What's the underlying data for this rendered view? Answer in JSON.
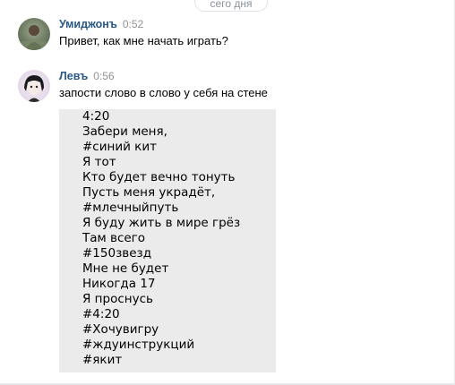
{
  "date_label": "сего дня",
  "messages": [
    {
      "author": "Умиджонъ",
      "time": "0:52",
      "text": "Привет, как мне начать играть?"
    },
    {
      "author": "Левъ",
      "time": "0:56",
      "text": "запости слово в слово у себя на стене"
    }
  ],
  "pasted_lines": [
    "4:20",
    "Забери меня,",
    "#синий кит",
    "Я тот",
    "Кто будет вечно тонуть",
    "Пусть меня украдёт,",
    "#млечныйпуть",
    "Я буду жить в мире грёз",
    "Там всего",
    "#150звезд",
    "Мне не будет",
    "Никогда 17",
    "Я проснусь",
    "#4:20",
    "#Хочувигру",
    "#ждуинструкций",
    "#якит"
  ]
}
